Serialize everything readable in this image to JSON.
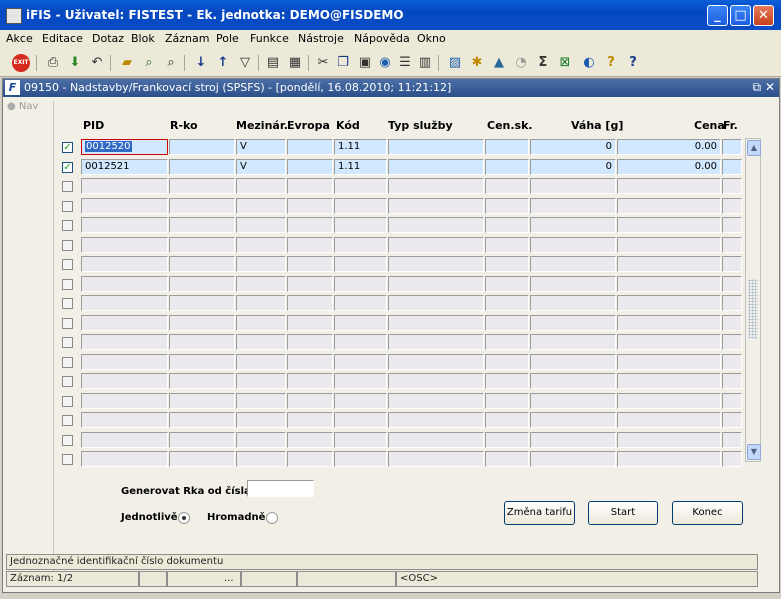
{
  "window": {
    "title": "iFIS - Uživatel: FISTEST - Ek. jednotka: DEMO@FISDEMO",
    "minimize": "_",
    "maximize": "□",
    "close": "✕"
  },
  "menu": [
    "Akce",
    "Editace",
    "Dotaz",
    "Blok",
    "Záznam",
    "Pole",
    "Funkce",
    "Nástroje",
    "Nápověda",
    "Okno"
  ],
  "toolbar": {
    "exit_label": "EXIT",
    "icons": [
      "exit-icon",
      "print-icon",
      "save-icon",
      "cancel-icon",
      "open-folder-icon",
      "search-icon",
      "find-icon",
      "sort-asc-icon",
      "sort-desc-icon",
      "filter-icon",
      "print-doc-icon",
      "print-preview-icon",
      "cut-icon",
      "copy-icon",
      "paste-icon",
      "delete-icon",
      "list-icon",
      "columns-icon",
      "tree-icon",
      "star-icon",
      "warning-icon",
      "calendar-icon",
      "sigma-icon",
      "excel-icon",
      "web-icon",
      "help-icon",
      "context-help-icon"
    ]
  },
  "form": {
    "title": "09150 - Nadstavby/Frankovací stroj (SPSFS) - [pondělí, 16.08.2010; 11:21:12]",
    "restore_icon": "⧉",
    "close_icon": "✕",
    "nav_label": "Nav",
    "columns": {
      "pid": "PID",
      "rko": "R-ko",
      "mezinar": "Mezinár.",
      "evropa": "Evropa",
      "kod": "Kód",
      "typ": "Typ služby",
      "censk": "Cen.sk.",
      "vaha": "Váha [g]",
      "cena": "Cena",
      "fr": "Fr."
    },
    "rows": [
      {
        "checked": true,
        "pid": "0012520",
        "rko": "",
        "mezinar": "V",
        "evropa": "",
        "kod": "1.11",
        "typ": "",
        "censk": "",
        "vaha": "0",
        "cena": "0.00",
        "fr": ""
      },
      {
        "checked": true,
        "pid": "0012521",
        "rko": "",
        "mezinar": "V",
        "evropa": "",
        "kod": "1.11",
        "typ": "",
        "censk": "",
        "vaha": "0",
        "cena": "0.00",
        "fr": ""
      },
      {
        "checked": false,
        "pid": "",
        "rko": "",
        "mezinar": "",
        "evropa": "",
        "kod": "",
        "typ": "",
        "censk": "",
        "vaha": "",
        "cena": "",
        "fr": ""
      },
      {
        "checked": false,
        "pid": "",
        "rko": "",
        "mezinar": "",
        "evropa": "",
        "kod": "",
        "typ": "",
        "censk": "",
        "vaha": "",
        "cena": "",
        "fr": ""
      },
      {
        "checked": false,
        "pid": "",
        "rko": "",
        "mezinar": "",
        "evropa": "",
        "kod": "",
        "typ": "",
        "censk": "",
        "vaha": "",
        "cena": "",
        "fr": ""
      },
      {
        "checked": false,
        "pid": "",
        "rko": "",
        "mezinar": "",
        "evropa": "",
        "kod": "",
        "typ": "",
        "censk": "",
        "vaha": "",
        "cena": "",
        "fr": ""
      },
      {
        "checked": false,
        "pid": "",
        "rko": "",
        "mezinar": "",
        "evropa": "",
        "kod": "",
        "typ": "",
        "censk": "",
        "vaha": "",
        "cena": "",
        "fr": ""
      },
      {
        "checked": false,
        "pid": "",
        "rko": "",
        "mezinar": "",
        "evropa": "",
        "kod": "",
        "typ": "",
        "censk": "",
        "vaha": "",
        "cena": "",
        "fr": ""
      },
      {
        "checked": false,
        "pid": "",
        "rko": "",
        "mezinar": "",
        "evropa": "",
        "kod": "",
        "typ": "",
        "censk": "",
        "vaha": "",
        "cena": "",
        "fr": ""
      },
      {
        "checked": false,
        "pid": "",
        "rko": "",
        "mezinar": "",
        "evropa": "",
        "kod": "",
        "typ": "",
        "censk": "",
        "vaha": "",
        "cena": "",
        "fr": ""
      },
      {
        "checked": false,
        "pid": "",
        "rko": "",
        "mezinar": "",
        "evropa": "",
        "kod": "",
        "typ": "",
        "censk": "",
        "vaha": "",
        "cena": "",
        "fr": ""
      },
      {
        "checked": false,
        "pid": "",
        "rko": "",
        "mezinar": "",
        "evropa": "",
        "kod": "",
        "typ": "",
        "censk": "",
        "vaha": "",
        "cena": "",
        "fr": ""
      },
      {
        "checked": false,
        "pid": "",
        "rko": "",
        "mezinar": "",
        "evropa": "",
        "kod": "",
        "typ": "",
        "censk": "",
        "vaha": "",
        "cena": "",
        "fr": ""
      },
      {
        "checked": false,
        "pid": "",
        "rko": "",
        "mezinar": "",
        "evropa": "",
        "kod": "",
        "typ": "",
        "censk": "",
        "vaha": "",
        "cena": "",
        "fr": ""
      },
      {
        "checked": false,
        "pid": "",
        "rko": "",
        "mezinar": "",
        "evropa": "",
        "kod": "",
        "typ": "",
        "censk": "",
        "vaha": "",
        "cena": "",
        "fr": ""
      },
      {
        "checked": false,
        "pid": "",
        "rko": "",
        "mezinar": "",
        "evropa": "",
        "kod": "",
        "typ": "",
        "censk": "",
        "vaha": "",
        "cena": "",
        "fr": ""
      },
      {
        "checked": false,
        "pid": "",
        "rko": "",
        "mezinar": "",
        "evropa": "",
        "kod": "",
        "typ": "",
        "censk": "",
        "vaha": "",
        "cena": "",
        "fr": ""
      }
    ],
    "generate_label": "Generovat Rka od čísla",
    "generate_value": "",
    "radio_single": "Jednotlivě",
    "radio_bulk": "Hromadně",
    "radio_selected": "single",
    "btn_change_tariff": "Změna tarifu",
    "btn_start": "Start",
    "btn_end": "Konec"
  },
  "status": {
    "hint": "Jednoznačné identifikační číslo dokumentu",
    "record": "Záznam: 1/2",
    "ellipsis": "...",
    "osc": "<OSC>"
  }
}
